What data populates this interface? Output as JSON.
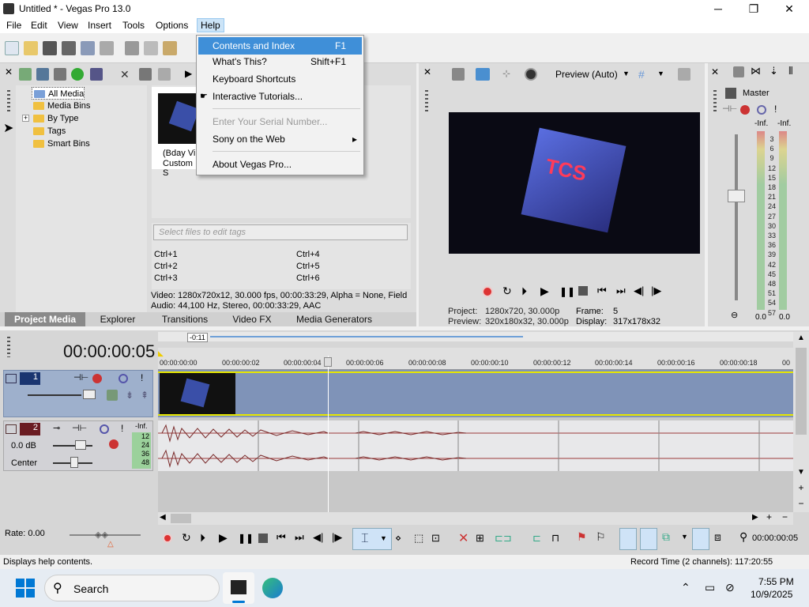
{
  "window": {
    "title": "Untitled * - Vegas Pro 13.0",
    "minimize": "─",
    "maximize": "❐",
    "close": "✕"
  },
  "menubar": [
    "File",
    "Edit",
    "View",
    "Insert",
    "Tools",
    "Options",
    "Help"
  ],
  "help_menu": {
    "items": [
      {
        "label": "Contents and Index",
        "shortcut": "F1",
        "state": "highlighted"
      },
      {
        "label": "What's This?",
        "shortcut": "Shift+F1",
        "state": "normal"
      },
      {
        "label": "Keyboard Shortcuts",
        "shortcut": "",
        "state": "normal"
      },
      {
        "label": "Interactive Tutorials...",
        "shortcut": "",
        "state": "normal"
      },
      {
        "label": "Enter Your Serial Number...",
        "shortcut": "",
        "state": "disabled"
      },
      {
        "label": "Sony on the Web",
        "shortcut": "▸",
        "state": "normal"
      },
      {
        "label": "About Vegas Pro...",
        "shortcut": "",
        "state": "normal"
      }
    ]
  },
  "media_tree": [
    "All Media",
    "Media Bins",
    "By Type",
    "Tags",
    "Smart Bins"
  ],
  "media_thumb_caption": [
    "(Bday Vi",
    "Custom S"
  ],
  "tags": {
    "placeholder": "Select files to edit tags",
    "shortcuts": [
      [
        "Ctrl+1",
        "Ctrl+4"
      ],
      [
        "Ctrl+2",
        "Ctrl+5"
      ],
      [
        "Ctrl+3",
        "Ctrl+6"
      ]
    ]
  },
  "media_info": {
    "video": "Video: 1280x720x12, 30.000 fps, 00:00:33:29, Alpha = None, Field",
    "audio": "Audio: 44,100 Hz, Stereo, 00:00:33:29, AAC"
  },
  "window_tabs": [
    "Project Media",
    "Explorer",
    "Transitions",
    "Video FX",
    "Media Generators"
  ],
  "preview": {
    "mode": "Preview (Auto)",
    "project_label": "Project:",
    "project_value": "1280x720, 30.000p",
    "preview_label": "Preview:",
    "preview_value": "320x180x32, 30.000p",
    "frame_label": "Frame:",
    "frame_value": "5",
    "display_label": "Display:",
    "display_value": "317x178x32"
  },
  "master": {
    "title": "Master",
    "left_inf": "-Inf.",
    "right_inf": "-Inf.",
    "scale": [
      "3",
      "6",
      "9",
      "12",
      "15",
      "18",
      "21",
      "24",
      "27",
      "30",
      "33",
      "36",
      "39",
      "42",
      "45",
      "48",
      "51",
      "54",
      "57"
    ],
    "left_val": "0.0",
    "right_val": "0.0"
  },
  "timeline": {
    "timecode": "00:00:00:05",
    "region_label": "-0:11",
    "ruler": [
      "00:00:00:00",
      "00:00:00:02",
      "00:00:00:04",
      "00:00:00:06",
      "00:00:00:08",
      "00:00:00:10",
      "00:00:00:12",
      "00:00:00:14",
      "00:00:00:16",
      "00:00:00:18",
      "00"
    ],
    "track1_num": "1",
    "track2_num": "2",
    "track2_volume": "0.0 dB",
    "track2_pan": "Center",
    "track2_meter_top": "-Inf.",
    "track2_meter": [
      "12",
      "24",
      "36",
      "48"
    ]
  },
  "transport": {
    "rate": "Rate: 0.00",
    "end_timecode": "00:00:00:05"
  },
  "status": {
    "left": "Displays help contents.",
    "right": "Record Time (2 channels): 117:20:55"
  },
  "taskbar": {
    "search": "Search",
    "time": "7:55 PM",
    "date": "10/9/2025"
  },
  "colors": {
    "highlight": "#3f8fd8",
    "track_video": "#7f93b8",
    "playhead": "#ffffff"
  }
}
